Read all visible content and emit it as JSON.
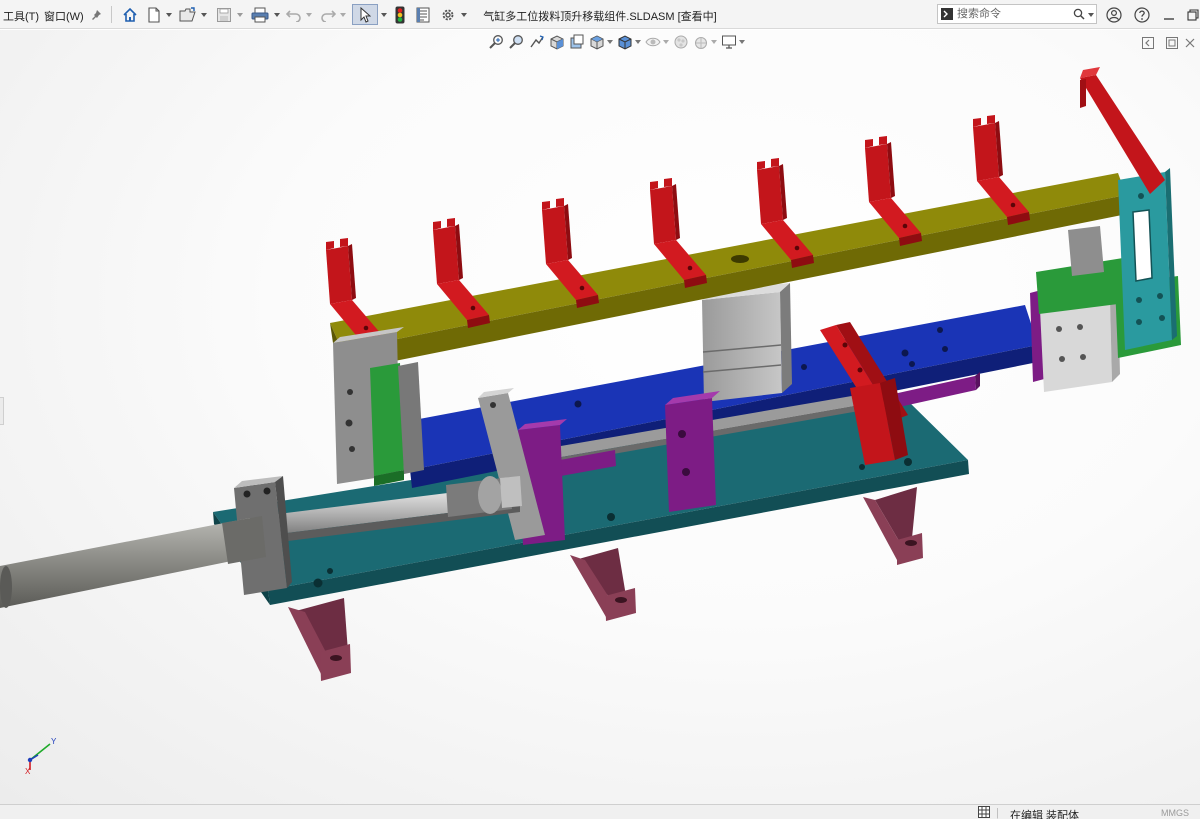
{
  "menu": {
    "tools": "工具(T)",
    "window": "窗口(W)"
  },
  "document": {
    "title": "气缸多工位拨料顶升移载组件.SLDASM [查看中]"
  },
  "search": {
    "placeholder": "搜索命令"
  },
  "statusbar": {
    "state": "在编辑 装配体",
    "units": "MMGS"
  },
  "triad": {
    "y_label": "Y",
    "x_label": "X"
  },
  "toolbar_icons": [
    "pin-icon",
    "home-icon",
    "new-document-icon",
    "open-folder-icon",
    "save-icon",
    "print-icon",
    "undo-icon",
    "redo-icon",
    "select-arrow-icon",
    "traffic-light-icon",
    "file-properties-icon",
    "gear-icon"
  ],
  "heads_up_icons": [
    "zoom-to-fit-icon",
    "zoom-to-area-icon",
    "previous-view-icon",
    "section-view-icon",
    "dynamic-annotation-icon",
    "view-orientation-icon",
    "display-style-icon",
    "hide-show-icon",
    "edit-appearance-icon",
    "apply-scene-icon",
    "view-settings-icon"
  ],
  "colors": {
    "accent_blue": "#1f5fb0",
    "beam_yellow": "#8f8a0a",
    "finger_red": "#c3151b",
    "rail_blue": "#1a34b6",
    "base_teal": "#1b6a73",
    "leg_maroon": "#8a3f56",
    "block_purple": "#7d1c85",
    "guide_green": "#2a9a3a",
    "bracket_cyan": "#2a9a9f",
    "cylinder_gray": "#8a8a85"
  }
}
